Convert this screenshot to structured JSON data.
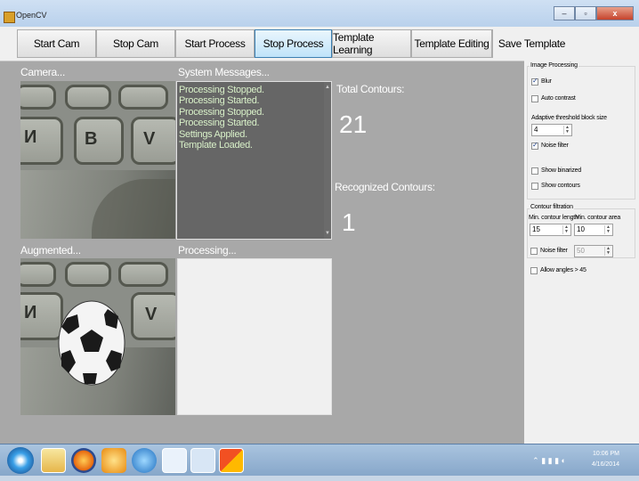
{
  "window": {
    "title": "OpenCV"
  },
  "toolbar": {
    "buttons": [
      "Start Cam",
      "Stop  Cam",
      "Start Process",
      "Stop Process",
      "Template Learning",
      "Template Editing",
      "Save Template"
    ]
  },
  "labels": {
    "camera": "Camera...",
    "system_messages": "System Messages...",
    "augmented": "Augmented...",
    "processing": "Processing...",
    "total_contours": "Total Contours:",
    "recognized_contours": "Recognized Contours:"
  },
  "counts": {
    "total": "21",
    "recognized": "1"
  },
  "messages": [
    "Processing Stopped.",
    "Processing Started.",
    "Processing Stopped.",
    "Processing Started.",
    "Settings Applied.",
    "Template Loaded."
  ],
  "keyboard_letters": [
    "И",
    "B",
    "V"
  ],
  "image_processing": {
    "group_title": "Image Processing",
    "blur": "Blur",
    "auto_contrast": "Auto contrast",
    "adaptive_label": "Adaptive threshold block size",
    "adaptive_value": "4",
    "noise_filter": "Noise filter",
    "show_binarized": "Show binarized",
    "show_contours": "Show contours"
  },
  "contour_filtration": {
    "group_title": "Contour filtration",
    "min_length_label": "Min. contour length",
    "min_area_label": "Min. contour area",
    "min_length_value": "15",
    "min_area_value": "10",
    "noise_filter": "Noise filter",
    "noise_value": "50",
    "allow_angles": "Allow angles > 45"
  },
  "tray": {
    "time": "10:06 PM",
    "date": "4/16/2014"
  }
}
